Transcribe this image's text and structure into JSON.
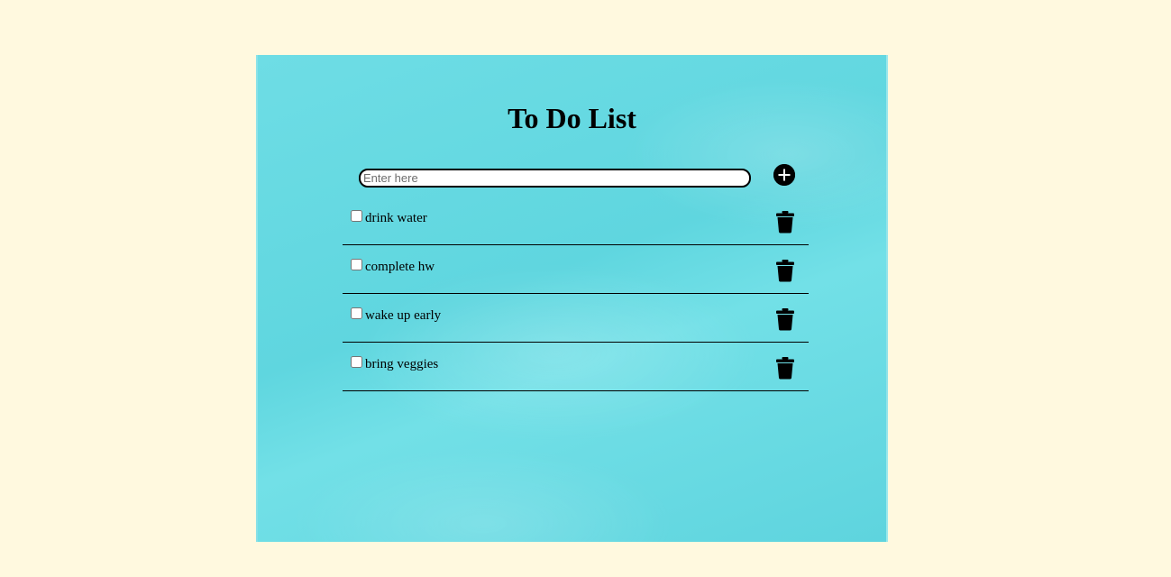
{
  "header": {
    "title": "To Do List"
  },
  "input": {
    "placeholder": "Enter here",
    "value": ""
  },
  "add_button": {
    "icon": "plus-circle-icon"
  },
  "tasks": [
    {
      "label": "drink water",
      "checked": false,
      "delete_icon": "trash-icon"
    },
    {
      "label": "complete hw",
      "checked": false,
      "delete_icon": "trash-icon"
    },
    {
      "label": "wake up early",
      "checked": false,
      "delete_icon": "trash-icon"
    },
    {
      "label": "bring veggies",
      "checked": false,
      "delete_icon": "trash-icon"
    }
  ],
  "colors": {
    "page_background": "#fff9df",
    "paper": "#63d8e0",
    "text": "#000000"
  }
}
